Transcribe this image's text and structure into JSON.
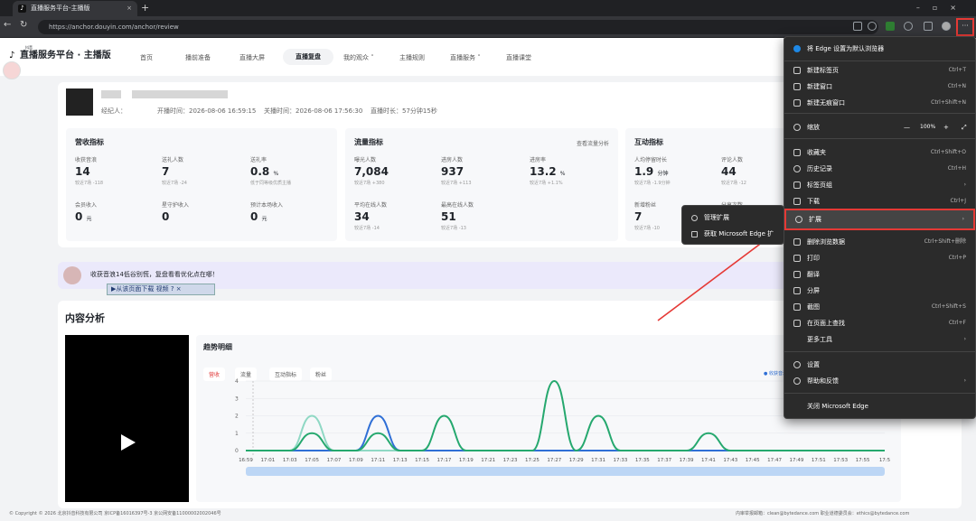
{
  "browser": {
    "tab_title": "直播服务平台-主播版",
    "url": "https://anchor.douyin.com/anchor/review",
    "tab_close": "×",
    "new_tab": "+",
    "more": "···"
  },
  "header": {
    "logo_small": "抖音",
    "logo": "直播服务平台 · 主播版",
    "nav": [
      "首页",
      "播前准备",
      "直播大屏",
      "直播复盘",
      "我的观众 ˅",
      "主播规则",
      "直播服务 ˅",
      "直播课堂"
    ],
    "active_nav": "直播复盘"
  },
  "session": {
    "agent_label": "经纪人：",
    "start": "开播时间：2026-08-06 16:59:15",
    "end": "关播时间：2026-08-06 17:56:30",
    "duration": "直播时长：57分钟15秒"
  },
  "revenue": {
    "title": "营收指标",
    "metrics": [
      {
        "label": "收获音浪",
        "value": "14",
        "unit": "",
        "sub": "较近7场 -118"
      },
      {
        "label": "送礼人数",
        "value": "7",
        "unit": "",
        "sub": "较近7场 -24"
      },
      {
        "label": "送礼率",
        "value": "0.8",
        "unit": "%",
        "sub": "低于同等级优质主播"
      },
      {
        "label": "会员收入",
        "value": "0",
        "unit": "元",
        "sub": ""
      },
      {
        "label": "星守护收入",
        "value": "0",
        "unit": "",
        "sub": ""
      },
      {
        "label": "预计本场收入",
        "value": "0",
        "unit": "元",
        "sub": ""
      }
    ]
  },
  "traffic": {
    "title": "流量指标",
    "link": "查看流量分析",
    "metrics": [
      {
        "label": "曝光人数",
        "value": "7,084",
        "unit": "",
        "sub": "较近7场 +380"
      },
      {
        "label": "进房人数",
        "value": "937",
        "unit": "",
        "sub": "较近7场 +113"
      },
      {
        "label": "进房率",
        "value": "13.2",
        "unit": "%",
        "sub": "较近7场 +1.1%"
      },
      {
        "label": "平均在线人数",
        "value": "34",
        "unit": "",
        "sub": "较近7场 -14"
      },
      {
        "label": "最高在线人数",
        "value": "51",
        "unit": "",
        "sub": "较近7场 -13"
      }
    ]
  },
  "interaction": {
    "title": "互动指标",
    "metrics": [
      {
        "label": "人均停留时长",
        "value": "1.9",
        "unit": "分钟",
        "sub": "较近7场 -1.9分钟"
      },
      {
        "label": "评论人数",
        "value": "44",
        "unit": "",
        "sub": "较近7场 -12"
      },
      {
        "label": "新增粉丝",
        "value": "7",
        "unit": "",
        "sub": "较近7场 -10"
      },
      {
        "label": "分享次数",
        "value": "",
        "unit": "",
        "sub": ""
      }
    ]
  },
  "banner": {
    "text": "收获音浪14低谷别慌，复盘看看优化点在哪！",
    "download": "▶从该页面下载 视频  ? ×"
  },
  "content": {
    "title": "内容分析",
    "trend_title": "趋势明细",
    "tabs": [
      "营收",
      "流量",
      "互动指标",
      "粉丝"
    ],
    "legend": "● 收获音浪"
  },
  "chart_data": {
    "type": "line",
    "title": "趋势明细",
    "xlabel": "",
    "ylabel": "",
    "ylim": [
      0,
      4
    ],
    "yticks": [
      0,
      1,
      2,
      3,
      4
    ],
    "x": [
      "16:59",
      "17:01",
      "17:03",
      "17:05",
      "17:07",
      "17:09",
      "17:11",
      "17:13",
      "17:15",
      "17:17",
      "17:19",
      "17:21",
      "17:23",
      "17:25",
      "17:27",
      "17:29",
      "17:31",
      "17:33",
      "17:35",
      "17:37",
      "17:39",
      "17:41",
      "17:43",
      "17:45",
      "17:47",
      "17:49",
      "17:51",
      "17:53",
      "17:55",
      "17:5"
    ],
    "series": [
      {
        "name": "收获音浪",
        "color": "#25a86e",
        "values": [
          0,
          0,
          0,
          1,
          0,
          0,
          1,
          0,
          0,
          2,
          0,
          0,
          0,
          0,
          4,
          0,
          2,
          0,
          0,
          0,
          0,
          1,
          0,
          0,
          0,
          0,
          0,
          0,
          0,
          0
        ]
      },
      {
        "name": "",
        "color": "#2f6fd6",
        "values": [
          0,
          0,
          0,
          0,
          0,
          0,
          2,
          0,
          0,
          0,
          0,
          0,
          0,
          0,
          0,
          0,
          0,
          0,
          0,
          0,
          0,
          0,
          0,
          0,
          0,
          0,
          0,
          0,
          0,
          0
        ]
      },
      {
        "name": "",
        "color": "#8fd8c4",
        "values": [
          0,
          0,
          0,
          2,
          0,
          0,
          0,
          0,
          0,
          0,
          0,
          0,
          0,
          0,
          0,
          0,
          0,
          0,
          0,
          0,
          0,
          0,
          0,
          0,
          0,
          0,
          0,
          0,
          0,
          0
        ]
      }
    ]
  },
  "menu": {
    "default_prompt": "将 Edge 设置为默认浏览器",
    "items": [
      {
        "label": "新建标签页",
        "kb": "Ctrl+T"
      },
      {
        "label": "新建窗口",
        "kb": "Ctrl+N"
      },
      {
        "label": "新建无痕窗口",
        "kb": "Ctrl+Shift+N"
      },
      {
        "label": "缩放",
        "kb": "100%"
      },
      {
        "label": "收藏夹",
        "kb": "Ctrl+Shift+O"
      },
      {
        "label": "历史记录",
        "kb": "Ctrl+H"
      },
      {
        "label": "标签页组",
        "kb": "›"
      },
      {
        "label": "下载",
        "kb": "Ctrl+J"
      },
      {
        "label": "扩展",
        "kb": "›"
      },
      {
        "label": "删除浏览数据",
        "kb": "Ctrl+Shift+删除"
      },
      {
        "label": "打印",
        "kb": "Ctrl+P"
      },
      {
        "label": "翻译",
        "kb": ""
      },
      {
        "label": "分屏",
        "kb": ""
      },
      {
        "label": "截图",
        "kb": "Ctrl+Shift+S"
      },
      {
        "label": "在页面上查找",
        "kb": "Ctrl+F"
      },
      {
        "label": "更多工具",
        "kb": "›"
      },
      {
        "label": "设置",
        "kb": ""
      },
      {
        "label": "帮助和反馈",
        "kb": "›"
      },
      {
        "label": "关闭 Microsoft Edge",
        "kb": ""
      }
    ],
    "submenu": [
      "管理扩展",
      "获取 Microsoft Edge 扩"
    ]
  },
  "footer": {
    "left": "© Copyright © 2026 北京抖音科技有限公司 京ICP备16016397号-3 京公网安备11000002002046号",
    "right": "内审举报邮箱：clean@bytedance.com    职业道德委员会：ethics@bytedance.com"
  }
}
